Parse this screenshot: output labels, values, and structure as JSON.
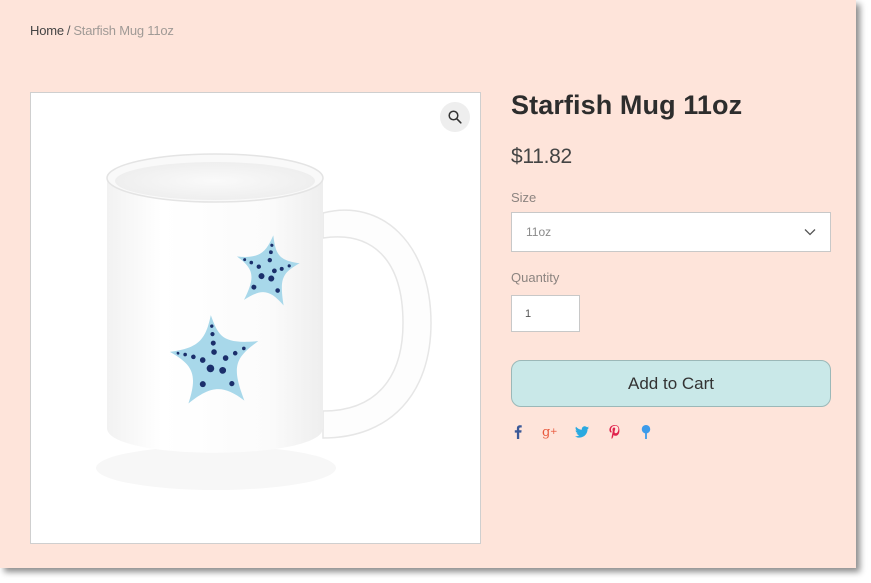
{
  "breadcrumb": {
    "home": "Home",
    "separator": "/",
    "current": "Starfish Mug 11oz"
  },
  "product": {
    "title": "Starfish Mug 11oz",
    "price": "$11.82",
    "image_alt": "White ceramic mug with two light blue starfish",
    "zoom_icon": "magnifier-icon"
  },
  "options": {
    "size_label": "Size",
    "size_value": "11oz",
    "quantity_label": "Quantity",
    "quantity_value": "1"
  },
  "actions": {
    "add_to_cart": "Add to Cart"
  },
  "share": [
    {
      "name": "facebook",
      "icon": "facebook-icon",
      "color": "#3b5998"
    },
    {
      "name": "google-plus",
      "icon": "google-plus-icon",
      "color": "#e8583c"
    },
    {
      "name": "twitter",
      "icon": "twitter-icon",
      "color": "#2aa9e0"
    },
    {
      "name": "pinterest",
      "icon": "pinterest-icon",
      "color": "#e0234d"
    },
    {
      "name": "fancy",
      "icon": "fancy-icon",
      "color": "#3c9bea"
    }
  ],
  "colors": {
    "page_background": "#fee4da",
    "button_background": "#c9e8e8",
    "starfish_light": "#a8d8ea",
    "starfish_dots": "#1b2f6b"
  }
}
